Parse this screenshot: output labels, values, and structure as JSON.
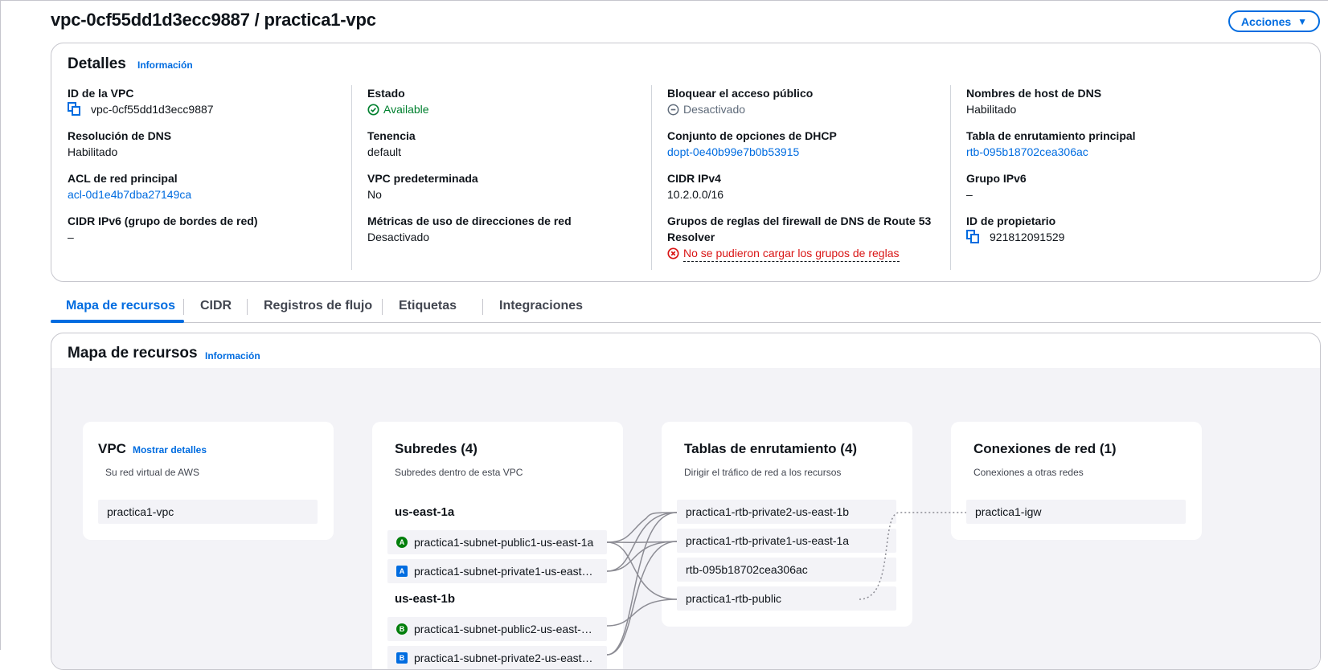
{
  "header": {
    "title": "vpc-0cf55dd1d3ecc9887 / practica1-vpc",
    "actions_label": "Acciones"
  },
  "details": {
    "title": "Detalles",
    "info_label": "Información",
    "columns": [
      [
        {
          "label": "ID de la VPC",
          "value": "vpc-0cf55dd1d3ecc9887",
          "style": "copy"
        },
        {
          "label": "Resolución de DNS",
          "value": "Habilitado",
          "style": "plain"
        },
        {
          "label": "ACL de red principal",
          "value": "acl-0d1e4b7dba27149ca",
          "style": "link"
        },
        {
          "label": "CIDR IPv6 (grupo de bordes de red)",
          "value": "–",
          "style": "plain"
        }
      ],
      [
        {
          "label": "Estado",
          "value": "Available",
          "style": "success"
        },
        {
          "label": "Tenencia",
          "value": "default",
          "style": "plain"
        },
        {
          "label": "VPC predeterminada",
          "value": "No",
          "style": "plain"
        },
        {
          "label": "Métricas de uso de direcciones de red",
          "value": "Desactivado",
          "style": "plain"
        }
      ],
      [
        {
          "label": "Bloquear el acceso público",
          "value": "Desactivado",
          "style": "disabled"
        },
        {
          "label": "Conjunto de opciones de DHCP",
          "value": "dopt-0e40b99e7b0b53915",
          "style": "link"
        },
        {
          "label": "CIDR IPv4",
          "value": "10.2.0.0/16",
          "style": "plain"
        },
        {
          "label": "Grupos de reglas del firewall de DNS de Route 53 Resolver",
          "value": "No se pudieron cargar los grupos de reglas",
          "style": "error"
        }
      ],
      [
        {
          "label": "Nombres de host de DNS",
          "value": "Habilitado",
          "style": "plain"
        },
        {
          "label": "Tabla de enrutamiento principal",
          "value": "rtb-095b18702cea306ac",
          "style": "link"
        },
        {
          "label": "Grupo IPv6",
          "value": "–",
          "style": "plain"
        },
        {
          "label": "ID de propietario",
          "value": "921812091529",
          "style": "copy"
        }
      ]
    ]
  },
  "tabs": [
    "Mapa de recursos",
    "CIDR",
    "Registros de flujo",
    "Etiquetas",
    "Integraciones"
  ],
  "resource_map": {
    "title": "Mapa de recursos",
    "info_label": "Información",
    "vpc": {
      "title": "VPC",
      "details_link": "Mostrar detalles",
      "subtitle": "Su red virtual de AWS",
      "name": "practica1-vpc"
    },
    "subnets": {
      "title": "Subredes (4)",
      "subtitle": "Subredes dentro de esta VPC",
      "groups": [
        {
          "az": "us-east-1a",
          "items": [
            {
              "badge": "A",
              "type": "public",
              "name": "practica1-subnet-public1-us-east-1a"
            },
            {
              "badge": "A",
              "type": "private",
              "name": "practica1-subnet-private1-us-east…"
            }
          ]
        },
        {
          "az": "us-east-1b",
          "items": [
            {
              "badge": "B",
              "type": "public",
              "name": "practica1-subnet-public2-us-east-…"
            },
            {
              "badge": "B",
              "type": "private",
              "name": "practica1-subnet-private2-us-east…"
            }
          ]
        }
      ]
    },
    "route_tables": {
      "title": "Tablas de enrutamiento (4)",
      "subtitle": "Dirigir el tráfico de red a los recursos",
      "items": [
        "practica1-rtb-private2-us-east-1b",
        "practica1-rtb-private1-us-east-1a",
        "rtb-095b18702cea306ac",
        "practica1-rtb-public"
      ]
    },
    "connections": {
      "title": "Conexiones de red (1)",
      "subtitle": "Conexiones a otras redes",
      "items": [
        "practica1-igw"
      ]
    }
  },
  "colors": {
    "accent": "#006ce0",
    "success": "#00802f",
    "error": "#d91515",
    "public_badge": "#037f0c"
  }
}
